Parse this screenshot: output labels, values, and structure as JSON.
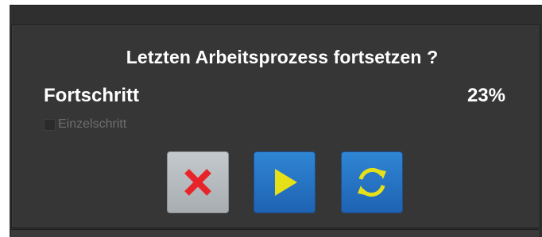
{
  "dialog": {
    "title": "Letzten Arbeitsprozess fortsetzen ?",
    "progress_label": "Fortschritt",
    "progress_value": "23%",
    "single_step_label": "Einzelschritt",
    "single_step_checked": false
  },
  "buttons": [
    {
      "name": "cancel",
      "icon": "close-icon",
      "color": "#e8242a"
    },
    {
      "name": "resume",
      "icon": "play-icon",
      "color": "#e6e019"
    },
    {
      "name": "restart",
      "icon": "refresh-icon",
      "color": "#e6e019"
    }
  ],
  "colors": {
    "background": "#363636",
    "text": "#ffffff",
    "disabled_text": "#6e6e6e",
    "button_blue": "#2a7acb",
    "button_gray": "#b5bbbe"
  }
}
